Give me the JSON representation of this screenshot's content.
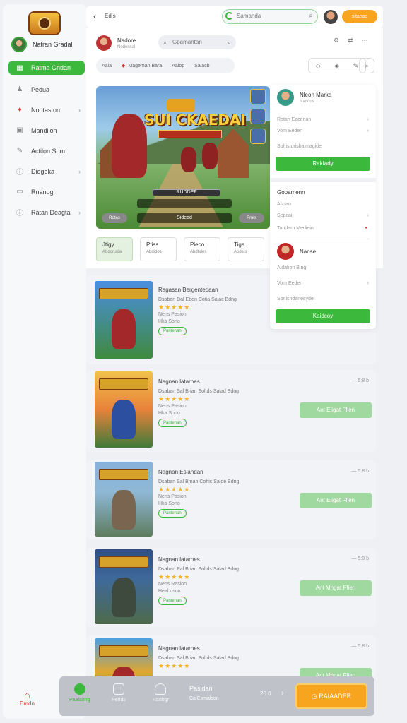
{
  "sidebar": {
    "user_name": "Natran Gradal",
    "items": [
      {
        "label": "Ratma Gndan",
        "icon": "gamepad-icon"
      },
      {
        "label": "Pedua",
        "icon": "users-icon"
      },
      {
        "label": "Nootaston",
        "icon": "heart-icon"
      },
      {
        "label": "Mandiion",
        "icon": "puzzle-icon"
      },
      {
        "label": "Actilon Som",
        "icon": "edit-icon"
      },
      {
        "label": "Diegoka",
        "icon": "info-icon"
      },
      {
        "label": "Rnanog",
        "icon": "image-icon"
      },
      {
        "label": "Ratan Deagta",
        "icon": "info-icon"
      }
    ],
    "bottom_label": "Emdn"
  },
  "topbar": {
    "title": "Edis",
    "search_placeholder": "Samanda",
    "button_label": "sitanas"
  },
  "main": {
    "game_name": "Nadore",
    "game_sub": "Nodonsal",
    "search_placeholder": "Gpamantan",
    "tabs": [
      "Aaia",
      "Mageman Bara",
      "Aalop",
      "Salacb"
    ],
    "hero": {
      "title": "SUI CKAEDAI",
      "hud_text": "RUDDEF",
      "left_button": "Rotas",
      "right_button": "Pnes",
      "bottom_text": "Sidead"
    },
    "filters": [
      {
        "label": "Jtigy",
        "sub": "Abdonsda"
      },
      {
        "label": "Ptiss",
        "sub": "Abdidos"
      },
      {
        "label": "Pieco",
        "sub": "Abdtides"
      },
      {
        "label": "Tiga",
        "sub": "Abdeis"
      }
    ]
  },
  "rpanel": {
    "top": {
      "name": "Nleon Marka",
      "sub": "Nadous",
      "line1": "Rotan Eacdnan",
      "line2": "Vom Eeden",
      "line3": "Sphistorisbalmagide",
      "button": "Rakfady"
    },
    "section_title": "Gopamenn",
    "lines": [
      "Asdan",
      "Sepcai",
      "Tandarn Mediein"
    ],
    "second": {
      "name": "Nanse",
      "line1": "Aldation Bing",
      "line2": "Vom Eeden",
      "line3": "Spnishdanesyde",
      "button": "Kaidcoy"
    }
  },
  "games": [
    {
      "title": "Ragasan Bergentedaan",
      "sub": "Dsaban Dal Eben Cotia Salac Bdng",
      "meta1": "Nens Pasion",
      "meta2": "Hka Sono",
      "tag": "Pantenan",
      "more": "",
      "button": ""
    },
    {
      "title": "Nagnan latarnes",
      "sub": "Dsaban Sal Brian Soltds Salad Bdng",
      "meta1": "Nens Pasion",
      "meta2": "Hka Sono",
      "tag": "Pantenan",
      "more": "— 5:8 b",
      "button": "Ant Eligat Ffien"
    },
    {
      "title": "Nagnan Eslandan",
      "sub": "Dsaban Sal Bmah Cohis Salde Bdng",
      "meta1": "Nens Pasion",
      "meta2": "Hka Sono",
      "tag": "Pantenan",
      "more": "— 5:8 b",
      "button": "Ant Eligat Ffien"
    },
    {
      "title": "Nagnan latarnes",
      "sub": "Dsaban Pal Brian Soltds Salad Bdng",
      "meta1": "Nens Rasion",
      "meta2": "Heal oson",
      "tag": "Pantenan",
      "more": "— 5:8 b",
      "button": "Ant Mhgat Ffien"
    },
    {
      "title": "Nagnan latarnes",
      "sub": "Dsaban Sal Brian Soltds Salad Bdng",
      "meta1": "",
      "meta2": "",
      "tag": "",
      "more": "— 5:8 b",
      "button": "Ant Mhgat Ffien"
    }
  ],
  "bottombar": {
    "items": [
      "Paalaong",
      "Pedds",
      "Raobgr"
    ],
    "text_title": "Pasidan",
    "text_sub": "Ca Esmalson",
    "count": "20.0",
    "cta": "RAIAADER"
  },
  "colors": {
    "accent": "#3cb83c",
    "cta": "#f7a51f",
    "stars": "#f2b428"
  }
}
